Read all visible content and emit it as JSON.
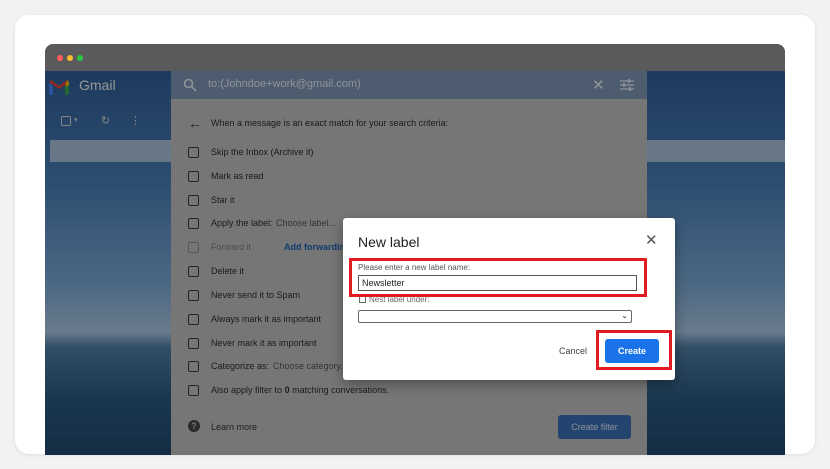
{
  "colors": {
    "highlight": "#e21a22",
    "primary_button": "#1a73e8",
    "link": "#1a5fb4"
  },
  "window": {
    "dots": [
      "red",
      "yellow",
      "green"
    ]
  },
  "gmail": {
    "app_name": "Gmail",
    "toolbar_icons": [
      "checkbox-icon",
      "chevron-down-icon",
      "refresh-icon",
      "more-vert-icon"
    ]
  },
  "search": {
    "query": "to:(Johndoe+work@gmail.com)",
    "criteria_text": "When a message is an exact match for your search criteria:",
    "options": [
      {
        "label": "Skip the Inbox (Archive it)"
      },
      {
        "label": "Mark as read"
      },
      {
        "label": "Star it"
      },
      {
        "label": "Apply the label:",
        "extra": "Choose label..."
      },
      {
        "label": "Forward it",
        "link": "Add forwarding ad"
      },
      {
        "label": "Delete it"
      },
      {
        "label": "Never send it to Spam"
      },
      {
        "label": "Always mark it as important"
      },
      {
        "label": "Never mark it as important"
      },
      {
        "label": "Categorize as:",
        "extra": "Choose category..."
      }
    ],
    "apply_prefix": "Also apply filter to",
    "apply_count": "0",
    "apply_suffix": "matching conversations.",
    "learn_more": "Learn more",
    "create_filter": "Create filter"
  },
  "modal": {
    "title": "New label",
    "name_label": "Please enter a new label name:",
    "name_value": "Newsletter",
    "nest_label": "Nest label under:",
    "nest_value": "",
    "cancel": "Cancel",
    "create": "Create"
  }
}
